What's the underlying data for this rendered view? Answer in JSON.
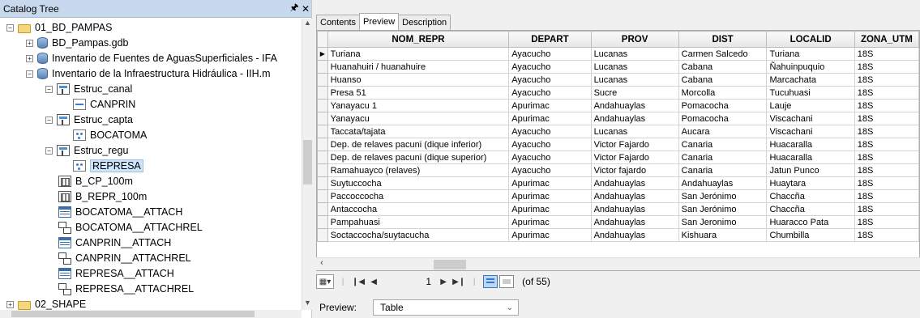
{
  "catalog": {
    "title": "Catalog Tree",
    "pin": "4",
    "close": "✕",
    "nodes": [
      {
        "label": "01_BD_PAMPAS",
        "expander": "−",
        "icon": "folder-icon"
      },
      {
        "label": "BD_Pampas.gdb",
        "expander": "+",
        "icon": "geodatabase-icon"
      },
      {
        "label": "Inventario de Fuentes de AguasSuperficiales - IFA",
        "expander": "+",
        "icon": "geodatabase-icon"
      },
      {
        "label": "Inventario de la Infraestructura Hidráulica - IIH.m",
        "expander": "−",
        "icon": "geodatabase-icon"
      },
      {
        "label": "Estruc_canal",
        "expander": "−",
        "icon": "feature-dataset-icon"
      },
      {
        "label": "CANPRIN",
        "expander": "",
        "icon": "line-feature-class-icon"
      },
      {
        "label": "Estruc_capta",
        "expander": "−",
        "icon": "feature-dataset-icon"
      },
      {
        "label": "BOCATOMA",
        "expander": "",
        "icon": "point-feature-class-icon"
      },
      {
        "label": "Estruc_regu",
        "expander": "−",
        "icon": "feature-dataset-icon"
      },
      {
        "label": "REPRESA",
        "expander": "",
        "icon": "point-feature-class-icon"
      },
      {
        "label": "B_CP_100m",
        "expander": "",
        "icon": "raster-icon"
      },
      {
        "label": "B_REPR_100m",
        "expander": "",
        "icon": "raster-icon"
      },
      {
        "label": "BOCATOMA__ATTACH",
        "expander": "",
        "icon": "table-icon"
      },
      {
        "label": "BOCATOMA__ATTACHREL",
        "expander": "",
        "icon": "relationship-class-icon"
      },
      {
        "label": "CANPRIN__ATTACH",
        "expander": "",
        "icon": "table-icon"
      },
      {
        "label": "CANPRIN__ATTACHREL",
        "expander": "",
        "icon": "relationship-class-icon"
      },
      {
        "label": "REPRESA__ATTACH",
        "expander": "",
        "icon": "table-icon"
      },
      {
        "label": "REPRESA__ATTACHREL",
        "expander": "",
        "icon": "relationship-class-icon"
      },
      {
        "label": "02_SHAPE",
        "expander": "+",
        "icon": "folder-icon"
      }
    ]
  },
  "tabs": [
    "Contents",
    "Preview",
    "Description"
  ],
  "active_tab": "Preview",
  "table": {
    "columns": [
      "NOM_REPR",
      "DEPART",
      "PROV",
      "DIST",
      "LOCALID",
      "ZONA_UTM"
    ],
    "rows": [
      [
        "Turiana",
        "Ayacucho",
        "Lucanas",
        "Carmen Salcedo",
        "Turiana",
        "18S"
      ],
      [
        "Huanahuiri / huanahuire",
        "Ayacucho",
        "Lucanas",
        "Cabana",
        "Ñahuinpuquio",
        "18S"
      ],
      [
        "Huanso",
        "Ayacucho",
        "Lucanas",
        "Cabana",
        "Marcachata",
        "18S"
      ],
      [
        "Presa 51",
        "Ayacucho",
        "Sucre",
        "Morcolla",
        "Tucuhuasi",
        "18S"
      ],
      [
        "Yanayacu 1",
        "Apurimac",
        "Andahuaylas",
        "Pomacocha",
        "Lauje",
        "18S"
      ],
      [
        "Yanayacu",
        "Apurimac",
        "Andahuaylas",
        "Pomacocha",
        "Viscachani",
        "18S"
      ],
      [
        "Taccata/tajata",
        "Ayacucho",
        "Lucanas",
        "Aucara",
        "Viscachani",
        "18S"
      ],
      [
        "Dep. de relaves pacuni (dique inferior)",
        "Ayacucho",
        "Victor Fajardo",
        "Canaria",
        "Huacaralla",
        "18S"
      ],
      [
        "Dep. de relaves pacuni (dique superior)",
        "Ayacucho",
        "Victor Fajardo",
        "Canaria",
        "Huacaralla",
        "18S"
      ],
      [
        "Ramahuayco (relaves)",
        "Ayacucho",
        "Victor fajardo",
        "Canaria",
        "Jatun Punco",
        "18S"
      ],
      [
        "Suytuccocha",
        "Apurimac",
        "Andahuaylas",
        "Andahuaylas",
        "Huaytara",
        "18S"
      ],
      [
        "Paccoccocha",
        "Apurimac",
        "Andahuaylas",
        "San Jerónimo",
        "Chaccña",
        "18S"
      ],
      [
        "Antaccocha",
        "Apurimac",
        "Andahuaylas",
        "San Jerónimo",
        "Chaccña",
        "18S"
      ],
      [
        "Pampahuasi",
        "Apurimac",
        "Andahuaylas",
        "San Jeronimo",
        "Huaracco Pata",
        "18S"
      ],
      [
        "Soctaccocha/suytacucha",
        "Apurimac",
        "Andahuaylas",
        "Kishuara",
        "Chumbilla",
        "18S"
      ]
    ]
  },
  "nav": {
    "current_record": "1",
    "record_count": "(of 55)"
  },
  "preview": {
    "label": "Preview:",
    "value": "Table"
  }
}
